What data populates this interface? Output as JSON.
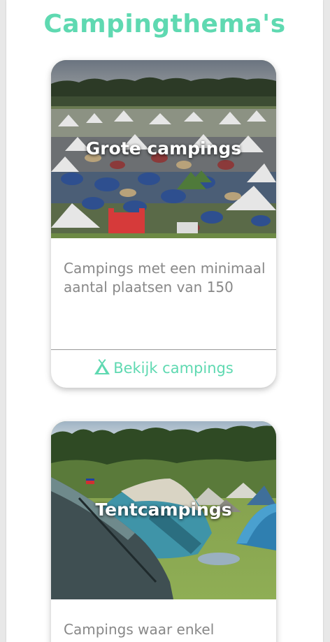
{
  "page": {
    "title": "Campingthema's"
  },
  "cards": [
    {
      "title": "Grote campings",
      "description": "Campings met een minimaal aantal plaatsen van 150",
      "link_label": "Bekijk campings",
      "link_icon": "tent-icon"
    },
    {
      "title": "Tentcampings",
      "description": "Campings waar enkel"
    }
  ],
  "colors": {
    "accent": "#5fd9b1",
    "text_muted": "#888888"
  }
}
